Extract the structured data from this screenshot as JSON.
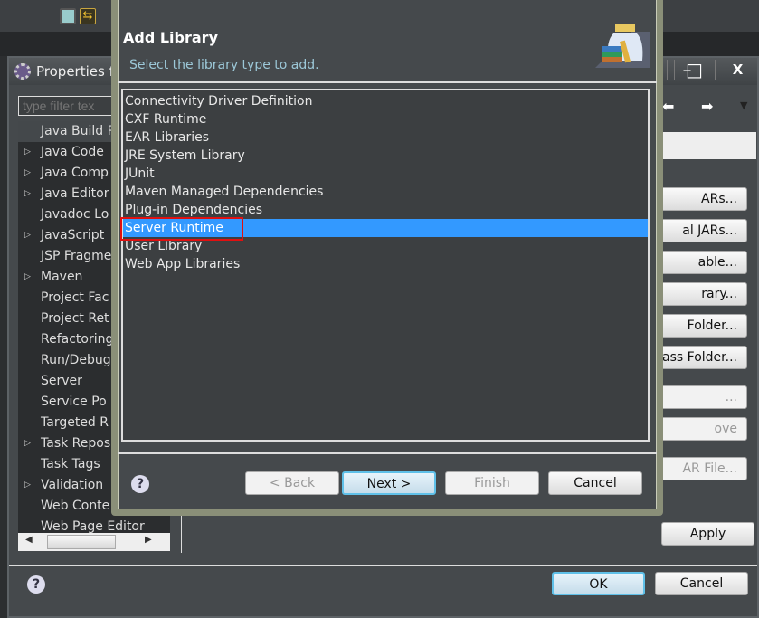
{
  "toolbar": {
    "icons": [
      "collapse-all-icon",
      "link-with-editor-icon"
    ]
  },
  "properties": {
    "title": "Properties f",
    "window_buttons": {
      "minimize": "‒",
      "maximize": "□",
      "close": "X"
    },
    "filter_placeholder": "type filter tex",
    "tree": [
      {
        "label": "Java Build P",
        "expandable": false,
        "selected": true
      },
      {
        "label": "Java Code",
        "expandable": true
      },
      {
        "label": "Java Comp",
        "expandable": true
      },
      {
        "label": "Java Editor",
        "expandable": true
      },
      {
        "label": "Javadoc Lo",
        "expandable": false
      },
      {
        "label": "JavaScript",
        "expandable": true
      },
      {
        "label": "JSP Fragme",
        "expandable": false
      },
      {
        "label": "Maven",
        "expandable": true
      },
      {
        "label": "Project Fac",
        "expandable": false
      },
      {
        "label": "Project Ret",
        "expandable": false
      },
      {
        "label": "Refactoring",
        "expandable": false
      },
      {
        "label": "Run/Debug",
        "expandable": false
      },
      {
        "label": "Server",
        "expandable": false
      },
      {
        "label": "Service Po",
        "expandable": false
      },
      {
        "label": "Targeted R",
        "expandable": false
      },
      {
        "label": "Task Repos",
        "expandable": true
      },
      {
        "label": "Task Tags",
        "expandable": false
      },
      {
        "label": "Validation",
        "expandable": true
      },
      {
        "label": "Web Conte",
        "expandable": false
      },
      {
        "label": "Web Page Editor",
        "expandable": false
      }
    ],
    "side_buttons": [
      {
        "label": "ARs...",
        "disabled": false
      },
      {
        "label": "al JARs...",
        "disabled": false
      },
      {
        "label": "able...",
        "disabled": false
      },
      {
        "label": "rary...",
        "disabled": false
      },
      {
        "label": "Folder...",
        "disabled": false
      },
      {
        "label": "lass Folder...",
        "disabled": false
      },
      {
        "label": "...",
        "disabled": true
      },
      {
        "label": "ove",
        "disabled": true
      },
      {
        "label": "AR File...",
        "disabled": true
      }
    ],
    "apply": "Apply",
    "ok": "OK",
    "cancel": "Cancel",
    "help": "?"
  },
  "dialog": {
    "title": "Add Library",
    "subtitle": "Select the library type to add.",
    "items": [
      "Connectivity Driver Definition",
      "CXF Runtime",
      "EAR Libraries",
      "JRE System Library",
      "JUnit",
      "Maven Managed Dependencies",
      "Plug-in Dependencies",
      "Server Runtime",
      "User Library",
      "Web App Libraries"
    ],
    "selected": "Server Runtime",
    "buttons": {
      "back": "< Back",
      "next": "Next >",
      "finish": "Finish",
      "cancel": "Cancel"
    },
    "help": "?"
  },
  "colors": {
    "selection": "#3399ff",
    "highlight_box": "#e01010"
  }
}
